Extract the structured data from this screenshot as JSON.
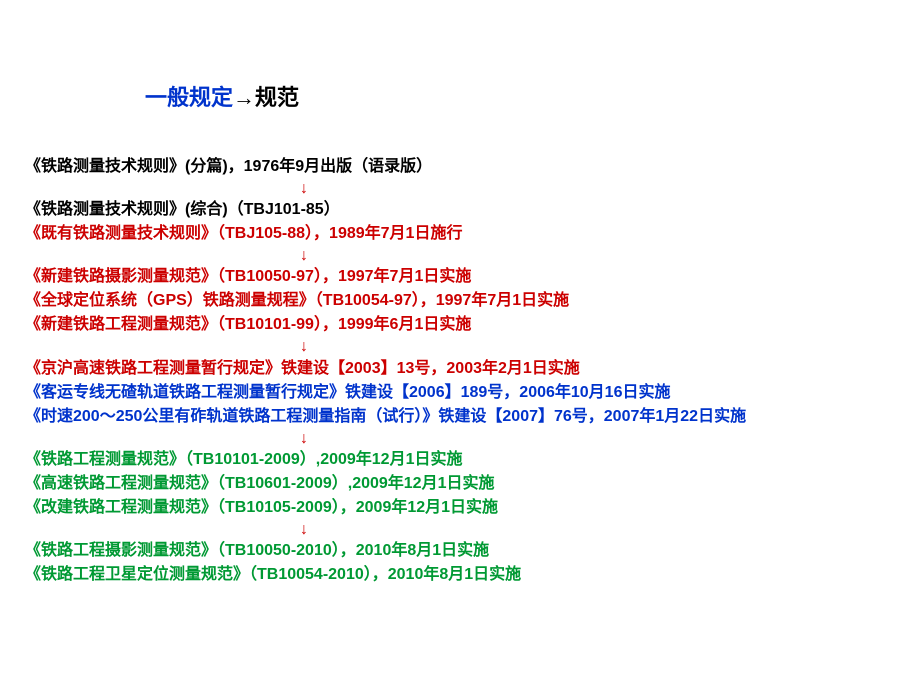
{
  "title": {
    "part1": "一般规定",
    "arrow": "→",
    "part2": "规范"
  },
  "arrow": "↓",
  "lines": {
    "l1": "《铁路测量技术规则》(分篇)，1976年9月出版（语录版）",
    "l2": "《铁路测量技术规则》(综合)（TBJ101-85）",
    "l3": "《既有铁路测量技术规则》（TBJ105-88），1989年7月1日施行",
    "l4": "《新建铁路摄影测量规范》（TB10050-97），1997年7月1日实施",
    "l5": "《全球定位系统（GPS）铁路测量规程》（TB10054-97），1997年7月1日实施",
    "l6": "《新建铁路工程测量规范》（TB10101-99），1999年6月1日实施",
    "l7": "《京沪高速铁路工程测量暂行规定》铁建设【2003】13号，2003年2月1日实施",
    "l8": "《客运专线无碴轨道铁路工程测量暂行规定》铁建设【2006】189号，2006年10月16日实施",
    "l9": "《时速200～250公里有砟轨道铁路工程测量指南（试行）》铁建设【2007】76号，2007年1月22日实施",
    "l10": "《铁路工程测量规范》（TB10101-2009）,2009年12月1日实施",
    "l11": "《高速铁路工程测量规范》（TB10601-2009）,2009年12月1日实施",
    "l12": "《改建铁路工程测量规范》（TB10105-2009），2009年12月1日实施",
    "l13": "《铁路工程摄影测量规范》（TB10050-2010），2010年8月1日实施",
    "l14": "《铁路工程卫星定位测量规范》（TB10054-2010），2010年8月1日实施"
  }
}
